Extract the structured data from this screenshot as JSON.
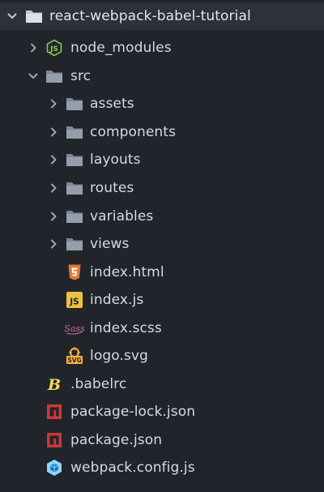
{
  "tree": {
    "root": {
      "label": "react-webpack-babel-tutorial",
      "icon": "folder-open-icon",
      "expanded": true
    },
    "node_modules": {
      "label": "node_modules",
      "icon": "nodejs-folder-icon",
      "expanded": false
    },
    "src": {
      "label": "src",
      "icon": "folder-open-icon",
      "expanded": true
    },
    "assets": {
      "label": "assets",
      "icon": "folder-icon",
      "expanded": false
    },
    "components": {
      "label": "components",
      "icon": "folder-icon",
      "expanded": false
    },
    "layouts": {
      "label": "layouts",
      "icon": "folder-icon",
      "expanded": false
    },
    "routes": {
      "label": "routes",
      "icon": "folder-icon",
      "expanded": false
    },
    "variables": {
      "label": "variables",
      "icon": "folder-icon",
      "expanded": false
    },
    "views": {
      "label": "views",
      "icon": "folder-icon",
      "expanded": false
    },
    "index_html": {
      "label": "index.html",
      "icon": "html5-icon"
    },
    "index_js": {
      "label": "index.js",
      "icon": "javascript-icon"
    },
    "index_scss": {
      "label": "index.scss",
      "icon": "sass-icon"
    },
    "logo_svg": {
      "label": "logo.svg",
      "icon": "svg-icon"
    },
    "babelrc": {
      "label": ".babelrc",
      "icon": "babel-icon"
    },
    "package_lock": {
      "label": "package-lock.json",
      "icon": "npm-icon"
    },
    "package_json": {
      "label": "package.json",
      "icon": "npm-icon"
    },
    "webpack_config": {
      "label": "webpack.config.js",
      "icon": "webpack-icon"
    }
  },
  "colors": {
    "background": "#21252b",
    "text": "#d7dae0",
    "folder": "#8f9aaa",
    "chevron": "#9da5b4",
    "node": "#8cc84b",
    "html": "#e37933",
    "js": "#f0c040",
    "sass": "#cc6699",
    "svg": "#ffb13b",
    "babel": "#f5da55",
    "npm": "#cb3837",
    "webpack": "#8ed6fb"
  }
}
